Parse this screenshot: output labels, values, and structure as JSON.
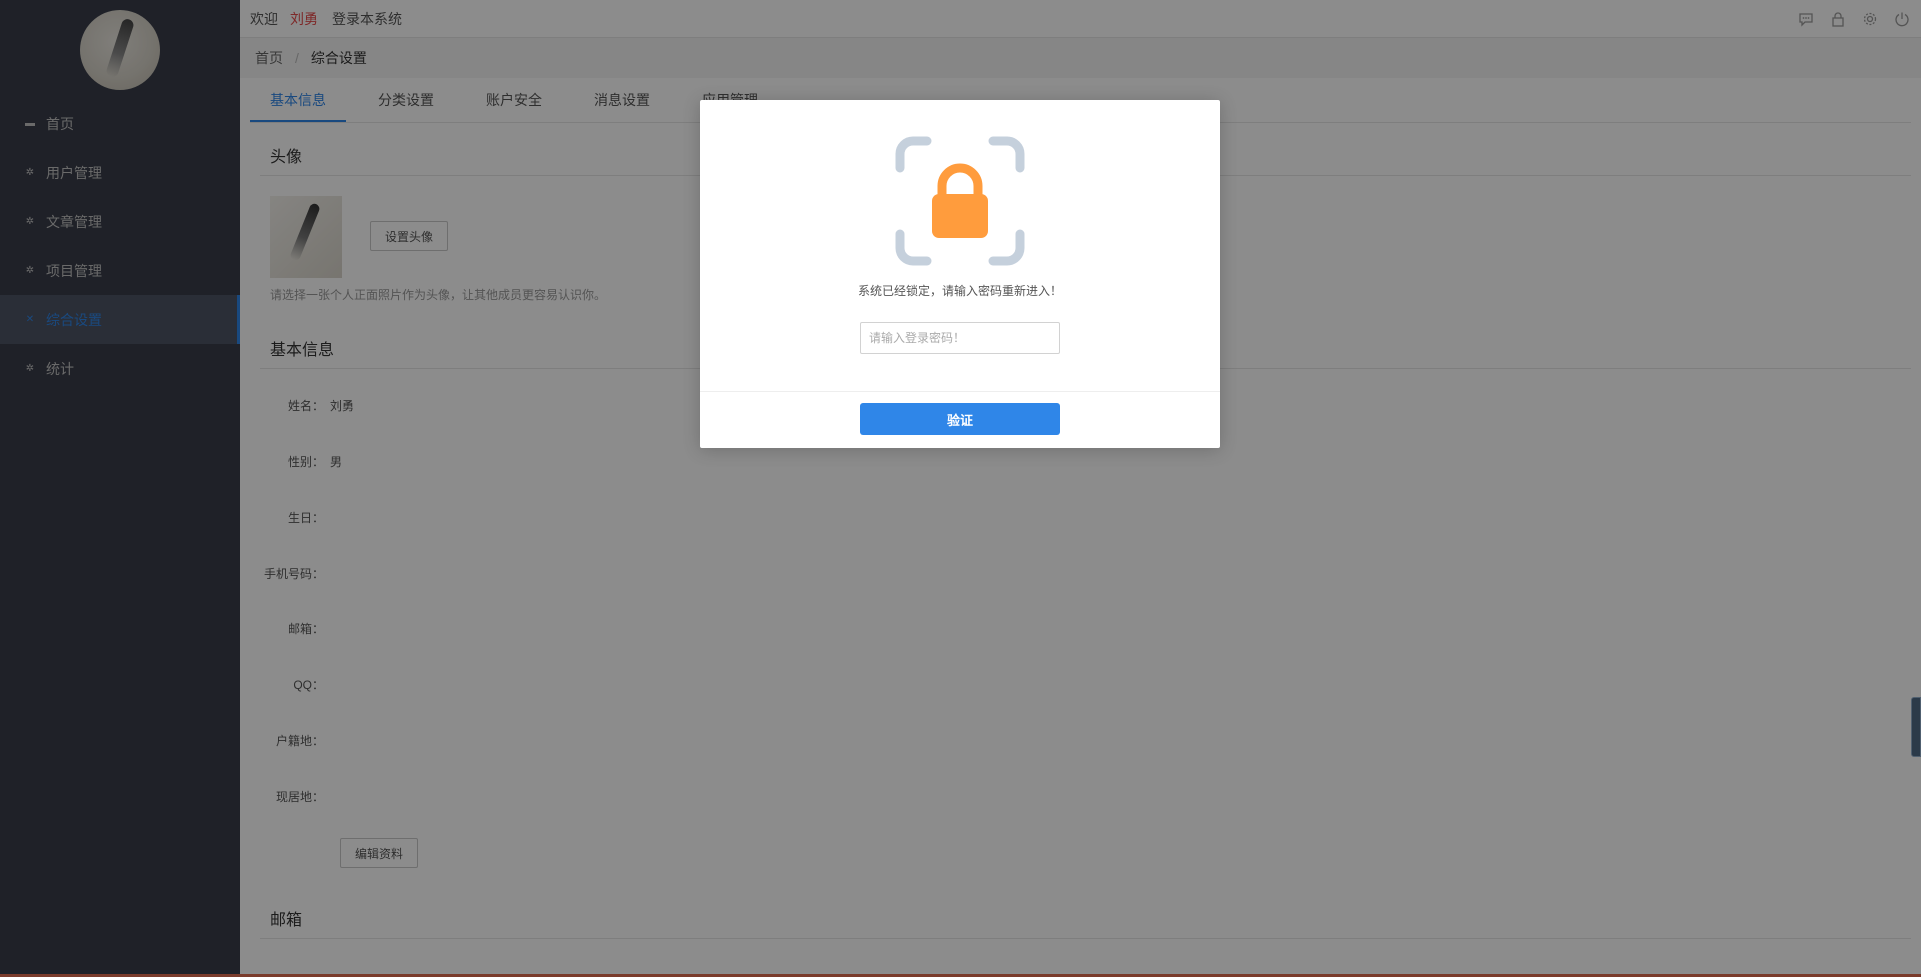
{
  "header": {
    "welcome": "欢迎",
    "username": "刘勇",
    "system_text": "登录本系统",
    "icons": [
      "chat-icon",
      "lock-icon",
      "gear-icon",
      "power-icon"
    ]
  },
  "sidebar": {
    "items": [
      {
        "label": "首页",
        "icon": "home-icon",
        "active": false
      },
      {
        "label": "用户管理",
        "icon": "user-icon",
        "active": false
      },
      {
        "label": "文章管理",
        "icon": "article-icon",
        "active": false
      },
      {
        "label": "项目管理",
        "icon": "project-icon",
        "active": false
      },
      {
        "label": "综合设置",
        "icon": "settings-icon",
        "active": true
      },
      {
        "label": "统计",
        "icon": "stats-icon",
        "active": false
      }
    ]
  },
  "breadcrumb": {
    "home": "首页",
    "current": "综合设置"
  },
  "tabs": [
    {
      "label": "基本信息",
      "active": true
    },
    {
      "label": "分类设置",
      "active": false
    },
    {
      "label": "账户安全",
      "active": false
    },
    {
      "label": "消息设置",
      "active": false
    },
    {
      "label": "应用管理",
      "active": false
    }
  ],
  "avatar_section": {
    "title": "头像",
    "set_button": "设置头像",
    "hint": "请选择一张个人正面照片作为头像，让其他成员更容易认识你。"
  },
  "basic_info": {
    "title": "基本信息",
    "fields": [
      {
        "label": "姓名：",
        "value": "刘勇"
      },
      {
        "label": "性别：",
        "value": "男"
      },
      {
        "label": "生日：",
        "value": ""
      },
      {
        "label": "手机号码：",
        "value": ""
      },
      {
        "label": "邮箱：",
        "value": ""
      },
      {
        "label": "QQ：",
        "value": ""
      },
      {
        "label": "户籍地：",
        "value": ""
      },
      {
        "label": "现居地：",
        "value": ""
      }
    ],
    "edit_button": "编辑资料"
  },
  "email_section": {
    "title": "邮箱"
  },
  "lock_modal": {
    "icon": "lock-icon",
    "message": "系统已经锁定，请输入密码重新进入！",
    "password_value": "",
    "password_placeholder": "请输入登录密码！",
    "verify_button": "验证",
    "lock_color": "#ff9c3d",
    "frame_color": "#c5d0dc"
  },
  "colors": {
    "accent": "#2f86e8",
    "sidebar_bg": "#393d49",
    "username": "#e54b4b"
  }
}
